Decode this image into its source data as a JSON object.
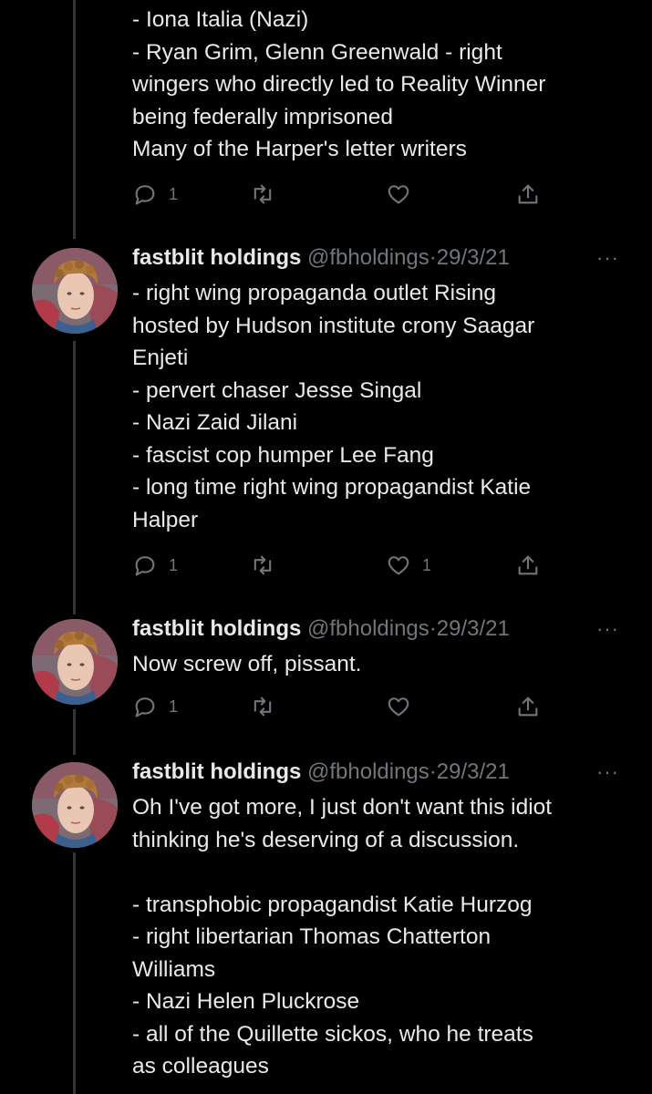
{
  "tweets": [
    {
      "lines": [
        "- Iona Italia (Nazi)",
        "- Ryan Grim, Glenn Greenwald - right",
        "wingers who directly led to Reality Winner",
        "being federally imprisoned",
        "Many of the Harper's letter writers"
      ],
      "reply_count": "1",
      "retweet_count": "",
      "like_count": ""
    },
    {
      "name": "fastblit holdings",
      "handle": "@fbholdings",
      "separator": "·",
      "date": "29/3/21",
      "more": "···",
      "lines": [
        "- right wing propaganda outlet Rising",
        "hosted by Hudson institute crony Saagar",
        "Enjeti",
        "- pervert chaser Jesse Singal",
        "- Nazi Zaid Jilani",
        "- fascist cop humper Lee Fang",
        "- long time right wing propagandist Katie",
        "Halper"
      ],
      "reply_count": "1",
      "retweet_count": "",
      "like_count": "1"
    },
    {
      "name": "fastblit holdings",
      "handle": "@fbholdings",
      "separator": "·",
      "date": "29/3/21",
      "more": "···",
      "lines": [
        "Now screw off, pissant."
      ],
      "reply_count": "1",
      "retweet_count": "",
      "like_count": ""
    },
    {
      "name": "fastblit holdings",
      "handle": "@fbholdings",
      "separator": "·",
      "date": "29/3/21",
      "more": "···",
      "lines": [
        "Oh I've got more, I just don't want this idiot",
        "thinking he's deserving of a discussion.",
        "",
        "- transphobic propagandist Katie Hurzog",
        "- right libertarian Thomas Chatterton",
        "Williams",
        "- Nazi Helen Pluckrose",
        "- all of the Quillette sickos, who he treats",
        "as colleagues"
      ]
    }
  ],
  "icons": {
    "reply": "reply-icon",
    "retweet": "retweet-icon",
    "like": "like-icon",
    "share": "share-icon",
    "more": "more-icon"
  },
  "colors": {
    "background": "#000000",
    "text": "#e7e9ea",
    "secondary": "#71767b",
    "thread_line": "#333639"
  }
}
